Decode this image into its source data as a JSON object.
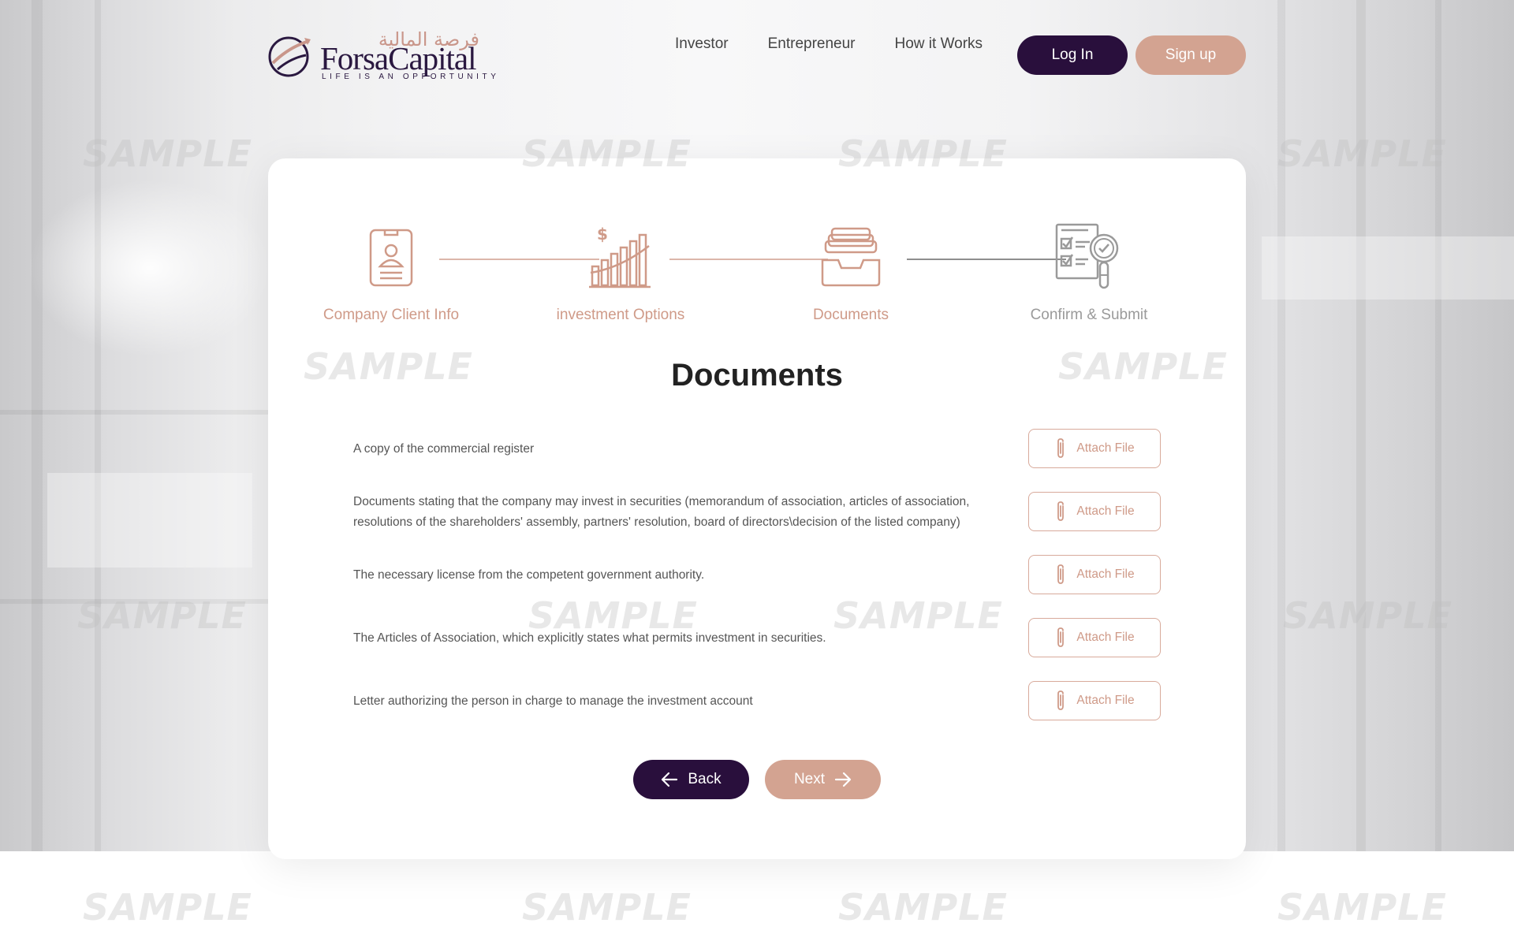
{
  "header": {
    "logo": {
      "arabic": "فرصة المالية",
      "name": "ForsaCapital",
      "tagline": "LIFE IS AN OPPORTUNITY"
    },
    "nav": [
      "Investor",
      "Entrepreneur",
      "How it Works"
    ],
    "login_label": "Log In",
    "signup_label": "Sign up"
  },
  "steps": [
    {
      "label": "Company Client Info",
      "icon": "client-profile-icon",
      "state": "done"
    },
    {
      "label": "investment Options",
      "icon": "investment-chart-icon",
      "state": "done"
    },
    {
      "label": "Documents",
      "icon": "documents-tray-icon",
      "state": "active"
    },
    {
      "label": "Confirm & Submit",
      "icon": "checklist-magnifier-icon",
      "state": "pending"
    }
  ],
  "page_title": "Documents",
  "documents": [
    {
      "text": "A copy of the commercial register",
      "action": "Attach File"
    },
    {
      "text": "Documents stating that the company may invest in securities (memorandum of association, articles of association, resolutions of the shareholders' assembly, partners' resolution, board of directors\\decision of the listed company)",
      "action": "Attach File"
    },
    {
      "text": "The necessary license from the competent government authority.",
      "action": "Attach File"
    },
    {
      "text": "The Articles of Association, which explicitly states what permits investment in securities.",
      "action": "Attach File"
    },
    {
      "text": "Letter authorizing the person in charge to manage the investment account",
      "action": "Attach File"
    }
  ],
  "buttons": {
    "back": "Back",
    "next": "Next"
  },
  "watermark": "SAMPLE",
  "colors": {
    "primary": "#290f3c",
    "accent": "#d3a391",
    "accent_text": "#cf9a88"
  }
}
